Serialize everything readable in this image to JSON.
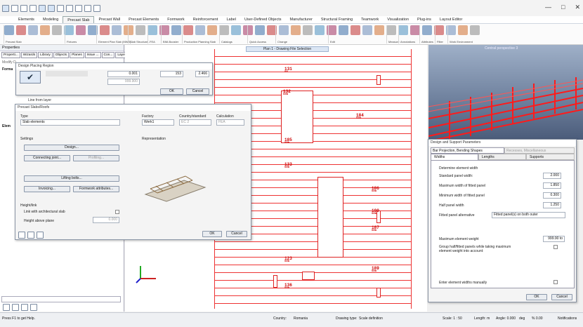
{
  "window": {
    "min": "—",
    "max": "□",
    "close": "✕"
  },
  "menu": [
    "Elements",
    "Modeling",
    "Precast Slab",
    "Precast Wall",
    "Precast Elements",
    "Formwork",
    "Reinforcement",
    "Label",
    "User-Defined Objects",
    "Manufacturer",
    "Structural Framing",
    "Teamwork",
    "Visualization",
    "Plug-ins",
    "Layout Editor"
  ],
  "ribbon_groups": [
    "Precast Slab",
    "Fixtures",
    "Element Plan Slab (MWS)",
    "Slab Structure...",
    "FEA",
    "BIM-Booster",
    "Production Planning Slab",
    "Catalogs",
    "Quick Access",
    "Change",
    "Edit",
    "Measure",
    "Annotations",
    "Attributes",
    "Filter",
    "Work Environment"
  ],
  "left": {
    "title": "Properties",
    "tabs": [
      "Properti...",
      "Wizards",
      "Library",
      "Objects",
      "Planes",
      "Issue ...",
      "Con...",
      "Layers"
    ],
    "modify": "Modify D",
    "formats": "Forma",
    "elem": "Elem",
    "line_from_layer": "Line from layer"
  },
  "view": {
    "plan_title": "Plan 1 - Drawing File Selection",
    "persp_title": "Central perspective 3"
  },
  "plan_labels": [
    {
      "n": "131",
      "s": "S0"
    },
    {
      "n": "132",
      "s": "S0b"
    },
    {
      "n": "184",
      "s": "S0b"
    },
    {
      "n": "185",
      "s": "S0b"
    },
    {
      "n": "133",
      "s": "S0b"
    },
    {
      "n": "186",
      "s": "S0b"
    },
    {
      "n": "190",
      "s": "S0b"
    },
    {
      "n": "187",
      "s": "S0b"
    },
    {
      "n": "123",
      "s": "S0b"
    },
    {
      "n": "189",
      "s": "S0b"
    },
    {
      "n": "136",
      "s": "S0b"
    }
  ],
  "placing": {
    "title": "Design Placing Region",
    "v1": "0.001",
    "v2": "153",
    "v3": "2.466",
    "v4": "999.900",
    "ok": "OK",
    "cancel": "Cancel"
  },
  "precast": {
    "title": "Precast Slabs/Roofs",
    "type_label": "Type",
    "type_value": "Slab elements",
    "factory_label": "Factory",
    "factory_value": "Werk1",
    "country_label": "Country/standard",
    "country_value": "EC 2",
    "calc_label": "Calculation",
    "calc_value": "FEA",
    "settings": "Settings",
    "representation": "Representation",
    "design": "Design...",
    "connecting": "Connecting joint...",
    "profiling": "Profiling...",
    "lifting": "Lifting bolts...",
    "invoicing": "Invoicing...",
    "formwork": "Formwork attributes...",
    "height_link": "Height/link",
    "link_arch": "Link with architectural slab",
    "height_above": "Height above plane",
    "height_value": "0.000",
    "ok": "OK",
    "cancel": "Cancel"
  },
  "support": {
    "title": "Design and Support Parameters",
    "tab_bar": "Bar Projection, Bending Shapes",
    "tab_recesses": "Recesses, Miscellaneous",
    "tab_widths": "Widths",
    "tab_lengths": "Lengths",
    "tab_supports": "Supports",
    "section": "Determine element width",
    "std_label": "Standard panel width:",
    "std_value": "2.000",
    "max_label": "Maximum width of fitted panel",
    "max_value": "1.850",
    "min_label": "Minimum width of fitted panel",
    "min_value": "0.300",
    "half_label": "Half panel width",
    "half_value": "1.250",
    "alt_label": "Fitted panel alternative",
    "alt_value": "Fitted panel(s) on both outer",
    "weight_label": "Maximum element weight",
    "weight_value": "999.90 to",
    "group_label": "Group half/fitted panels while taking maximum element weight into account:",
    "manual_label": "Enter element widths manually",
    "ok": "OK",
    "cancel": "Cancel"
  },
  "status": {
    "help": "Press F1 to get Help.",
    "country": "Country:",
    "country_val": "Romania",
    "dtype": "Drawing type:",
    "dtype_val": "Scale definition",
    "scale": "Scale: 1 : 50",
    "length": "Length: m",
    "angle": "Angle: 0.000",
    "deg": "deg",
    "pct": "% 0.00",
    "notif": "Notifications"
  }
}
